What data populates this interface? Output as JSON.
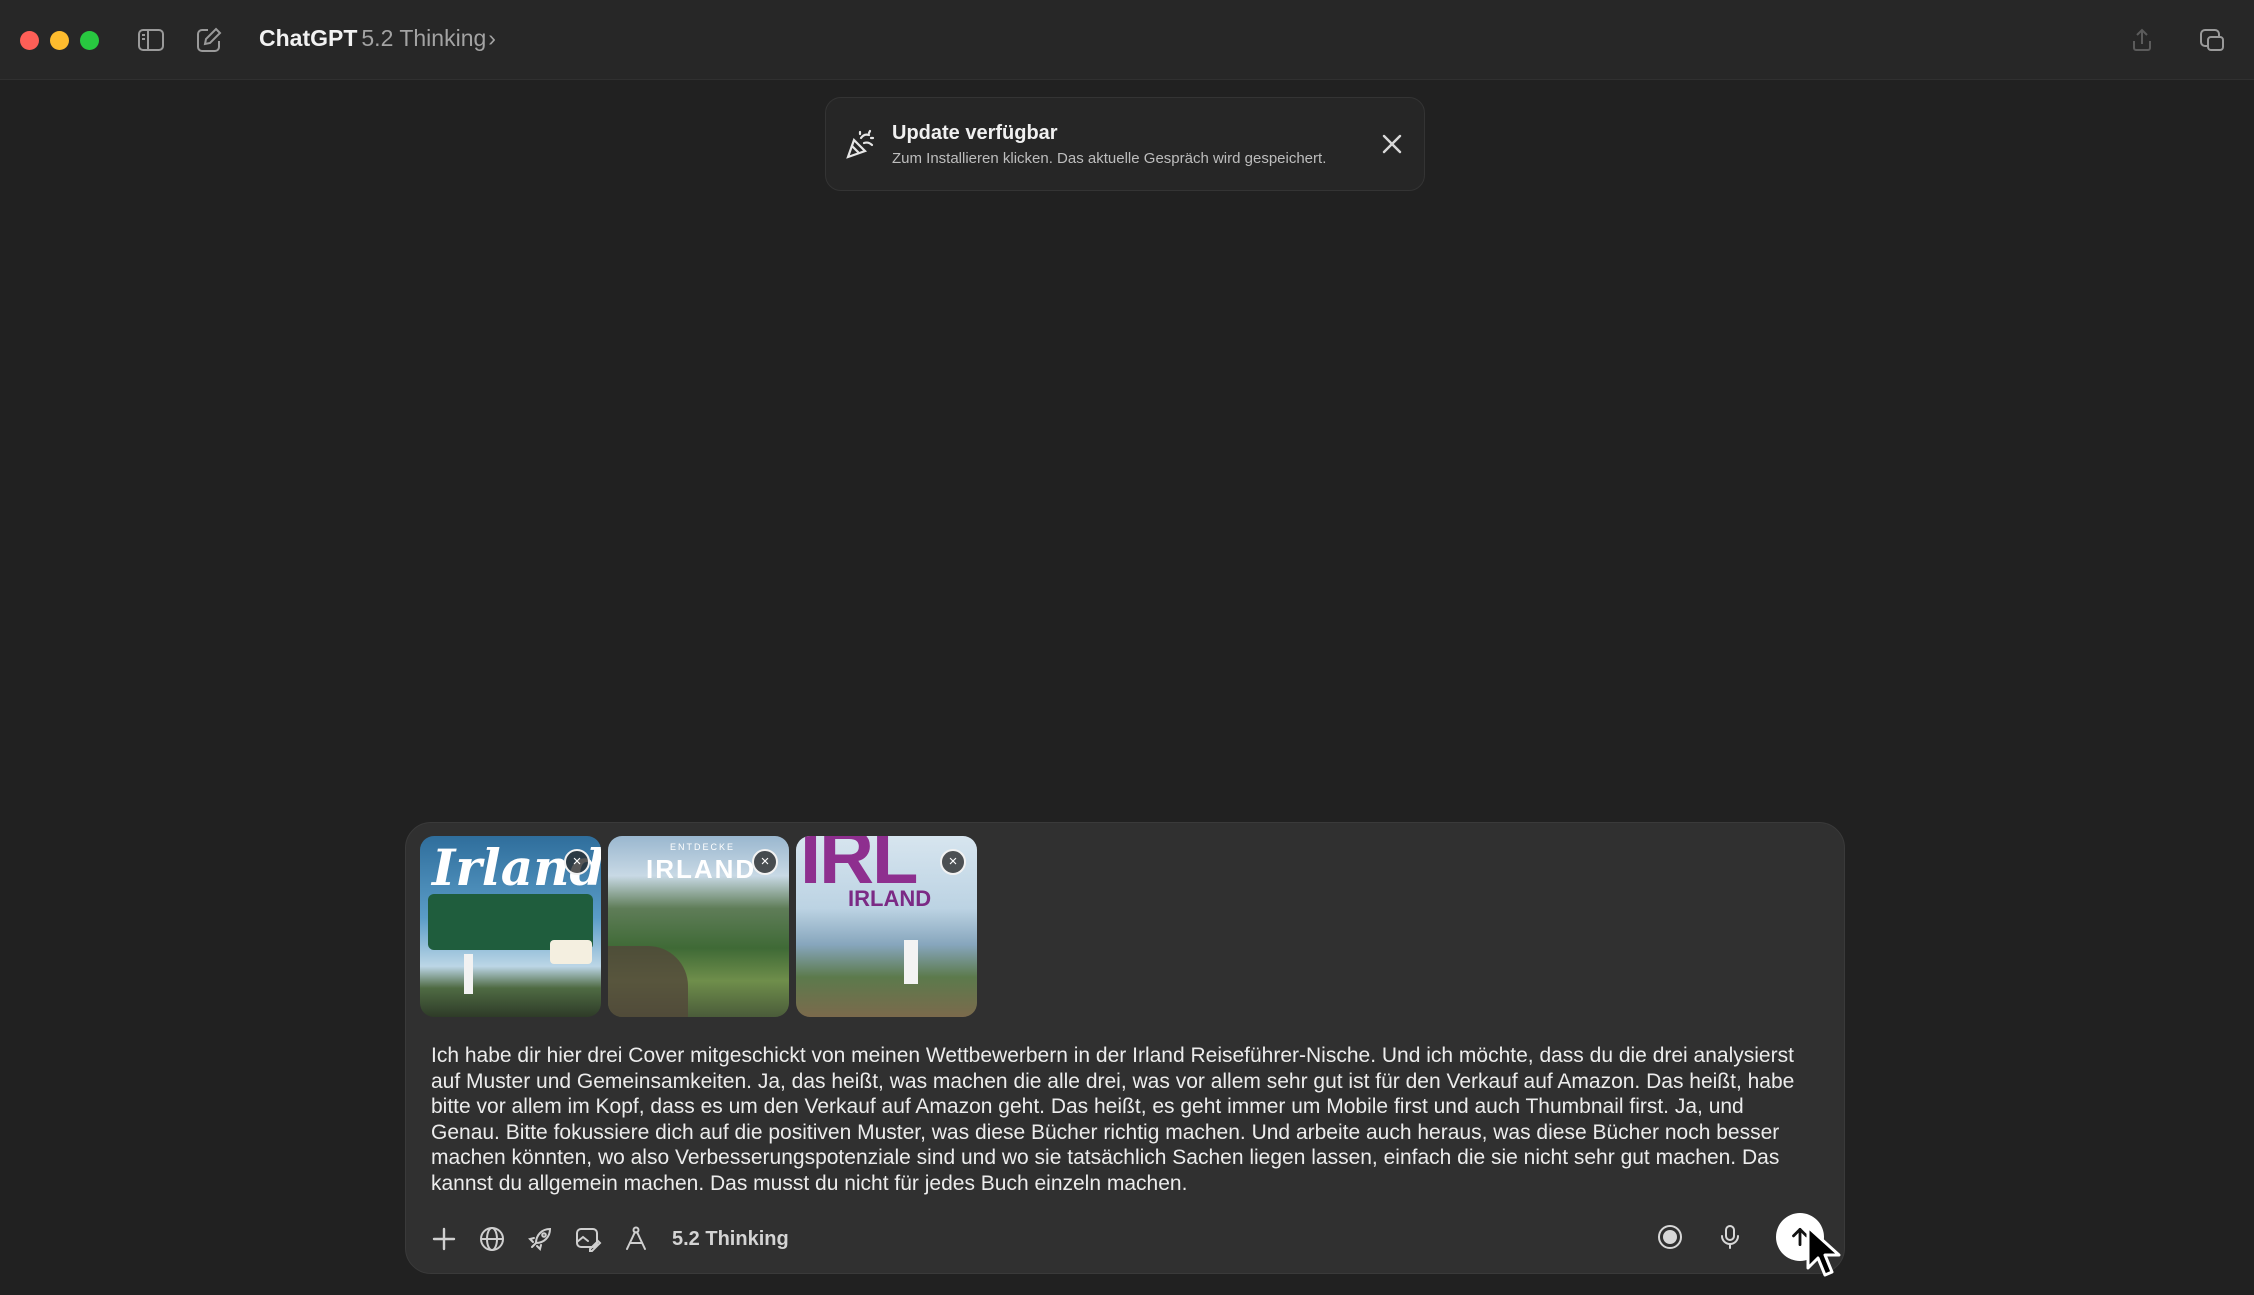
{
  "titlebar": {
    "app_name": "ChatGPT",
    "model": "5.2 Thinking",
    "chevron": "›",
    "icons": [
      "sidebar-toggle-icon",
      "new-chat-icon",
      "share-icon",
      "new-window-icon"
    ]
  },
  "toast": {
    "title": "Update verfügbar",
    "subtitle": "Zum Installieren klicken. Das aktuelle Gespräch wird gespeichert.",
    "close": "close-icon"
  },
  "composer": {
    "attachments": [
      {
        "cover_title": "Irland",
        "remove": "×"
      },
      {
        "cover_title": "IRLAND",
        "cover_kicker": "ENTDECKE",
        "remove": "×"
      },
      {
        "cover_title": "IRLAND",
        "cover_big": "IRL",
        "remove": "×"
      }
    ],
    "text": "Ich habe dir hier drei Cover mitgeschickt von meinen Wettbewerbern in der Irland Reiseführer-Nische. Und ich möchte, dass du die drei analysierst auf Muster und Gemeinsamkeiten. Ja, das heißt, was machen die alle drei, was vor allem sehr gut ist für den Verkauf auf Amazon. Das heißt, habe bitte vor allem im Kopf, dass es um den Verkauf auf Amazon geht. Das heißt, es geht immer um Mobile first und auch Thumbnail first. Ja, und Genau. Bitte fokussiere dich auf die positiven Muster, was diese Bücher richtig machen. Und arbeite auch heraus, was diese Bücher noch besser machen könnten, wo also Verbesserungspotenziale sind und wo sie tatsächlich Sachen liegen lassen, einfach die sie nicht sehr gut machen. Das kannst du allgemein machen. Das musst du nicht für jedes Buch einzeln machen.",
    "model_label": "5.2 Thinking",
    "tools": [
      "plus-icon",
      "globe-icon",
      "rocket-icon",
      "image-edit-icon",
      "compass-icon"
    ],
    "right_tools": [
      "record-icon",
      "microphone-icon",
      "send-arrow-icon"
    ]
  },
  "colors": {
    "background": "#212121",
    "composer": "#303030",
    "close_red": "#ff5f57",
    "minimize_yellow": "#febc2e",
    "maximize_green": "#28c840"
  }
}
